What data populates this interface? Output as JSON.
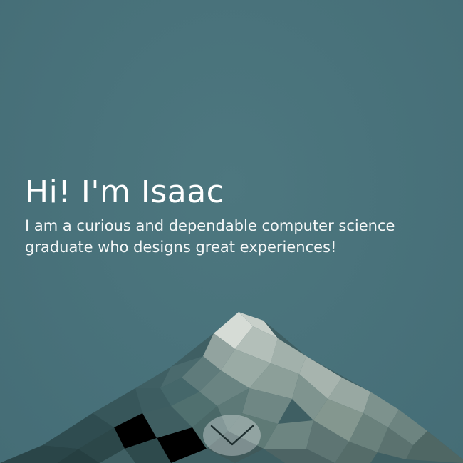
{
  "hero": {
    "title": "Hi! I'm Isaac",
    "subtitle_line1": "I am a curious and dependable computer science",
    "subtitle_line2": "graduate who designs great experiences!"
  },
  "scroll_button": {
    "icon": "chevron-down-icon"
  },
  "colors": {
    "background": "#4a737b",
    "text": "#ffffff"
  }
}
